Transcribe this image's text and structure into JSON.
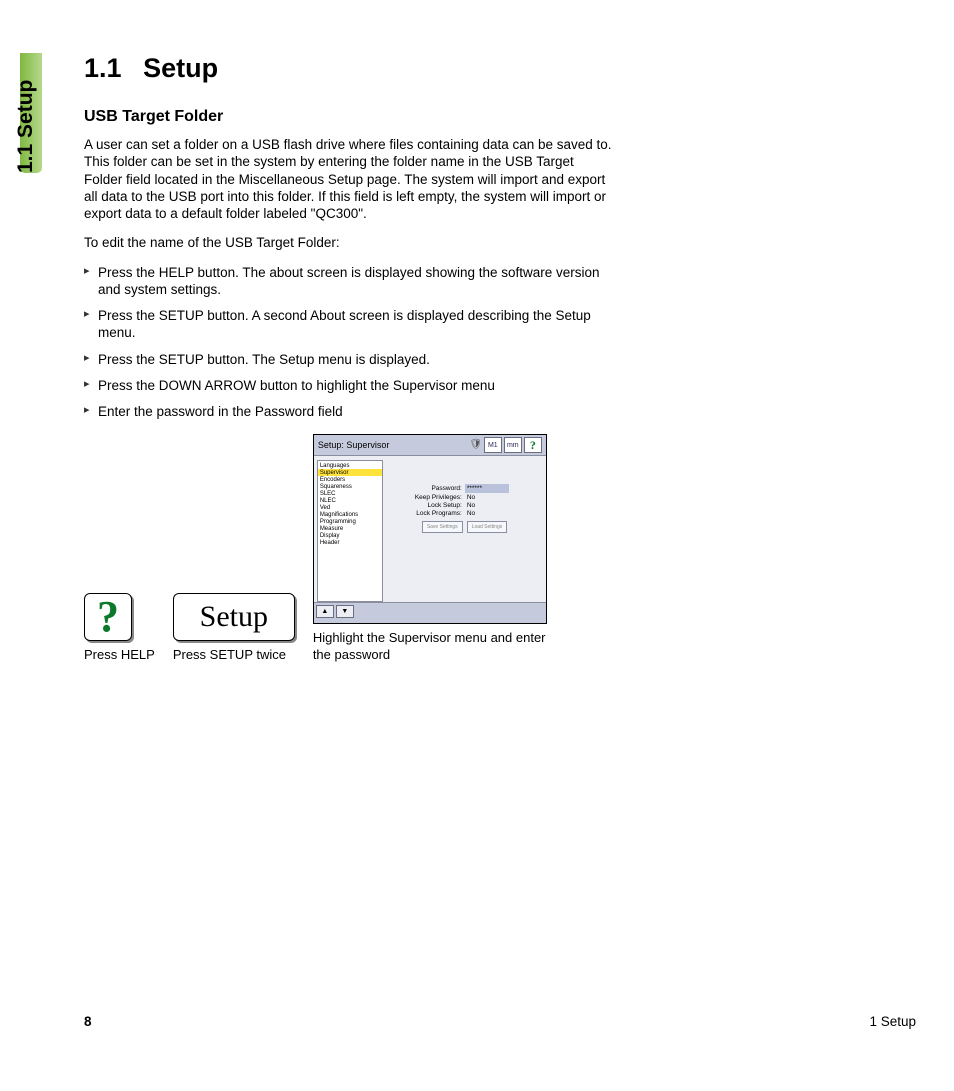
{
  "side_label": "1.1 Setup",
  "heading_number": "1.1",
  "heading_text": "Setup",
  "subheading": "USB Target Folder",
  "paragraph_1": "A user can set a folder on a USB flash drive where files containing data can be saved to. This folder can be set in the system by entering the folder name in the USB Target Folder field located in the Miscellaneous Setup page. The system will import and export all data to the USB port into this folder. If this field is left empty, the system will import or export data to a default folder labeled \"QC300\".",
  "paragraph_2": "To edit the name of the USB Target Folder:",
  "steps": [
    "Press the HELP button. The about screen is displayed showing the software version and system settings.",
    "Press the SETUP button. A second About screen is displayed describing the Setup menu.",
    "Press the SETUP button. The Setup menu is displayed.",
    "Press the DOWN ARROW button to highlight the Supervisor menu",
    "Enter the password in the Password field"
  ],
  "figures": {
    "help": {
      "glyph": "?",
      "caption": "Press HELP"
    },
    "setup": {
      "label": "Setup",
      "caption": "Press SETUP twice"
    },
    "supervisor": {
      "title": "Setup: Supervisor",
      "toolbar": {
        "m1": "M1",
        "mm": "mm",
        "q": "?"
      },
      "sidebar": [
        {
          "label": "Languages",
          "selected": false
        },
        {
          "label": "Supervisor",
          "selected": true
        },
        {
          "label": "Encoders",
          "selected": false
        },
        {
          "label": "Squareness",
          "selected": false
        },
        {
          "label": "SLEC",
          "selected": false
        },
        {
          "label": "NLEC",
          "selected": false
        },
        {
          "label": "Ved",
          "selected": false
        },
        {
          "label": "Magnifications",
          "selected": false
        },
        {
          "label": "Programming",
          "selected": false
        },
        {
          "label": "Measure",
          "selected": false
        },
        {
          "label": "Display",
          "selected": false
        },
        {
          "label": "Header",
          "selected": false
        }
      ],
      "fields": {
        "password_label": "Password:",
        "password_value": "******",
        "keep_priv_label": "Keep Privileges:",
        "keep_priv_value": "No",
        "lock_setup_label": "Lock Setup:",
        "lock_setup_value": "No",
        "lock_programs_label": "Lock Programs:",
        "lock_programs_value": "No"
      },
      "buttons": {
        "save": "Save Settings",
        "load": "Load Settings"
      },
      "caption": "Highlight the Supervisor menu and enter the password"
    }
  },
  "footer": {
    "page_number": "8",
    "section": "1 Setup"
  }
}
